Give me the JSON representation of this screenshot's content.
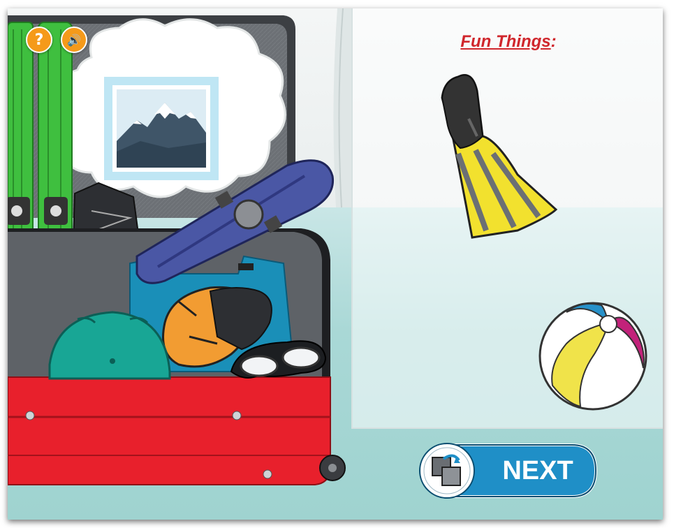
{
  "panel": {
    "title": "Fun Things",
    "title_suffix": ":"
  },
  "controls": {
    "help_icon": "question-mark",
    "sound_icon": "speaker",
    "help_glyph": "?",
    "sound_glyph": "🔊"
  },
  "next_button": {
    "label": "NEXT",
    "icon": "swap-cards"
  },
  "colors": {
    "title_red": "#d0262c",
    "button_blue": "#1f8fc7",
    "button_orange": "#f59a1a",
    "suitcase_red": "#e8202c"
  },
  "items": {
    "in_suitcase": [
      "skis",
      "snow boots",
      "snowboard",
      "jacket",
      "ski vest",
      "gloves",
      "helmet",
      "goggles"
    ],
    "fun_things": [
      "swim fin",
      "beach ball"
    ],
    "thought_bubble": "mountain picture"
  }
}
